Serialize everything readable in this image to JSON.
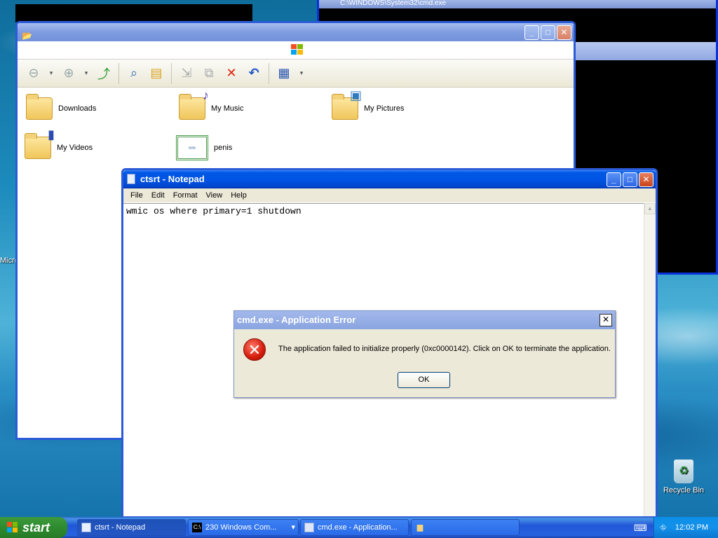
{
  "background_window": {
    "title": "C:\\WINDOWS\\System32\\cmd.exe"
  },
  "explorer": {
    "items": [
      {
        "label": "Downloads"
      },
      {
        "label": "My Music"
      },
      {
        "label": "My Pictures"
      },
      {
        "label": "My Videos"
      },
      {
        "label": "penis"
      }
    ]
  },
  "notepad": {
    "title": "ctsrt - Notepad",
    "menu": [
      "File",
      "Edit",
      "Format",
      "View",
      "Help"
    ],
    "content": "wmic os where primary=1 shutdown"
  },
  "dialog": {
    "title": "cmd.exe - Application Error",
    "message": "The application failed to initialize properly (0xc0000142). Click on OK to terminate the application.",
    "ok_label": "OK"
  },
  "desktop": {
    "recycle_bin_label": "Recycle Bin",
    "left_partial_label": "Micro"
  },
  "taskbar": {
    "start_label": "start",
    "tasks": [
      {
        "label": "ctsrt - Notepad"
      },
      {
        "label": "230 Windows Com..."
      },
      {
        "label": "cmd.exe - Application..."
      },
      {
        "label": ""
      }
    ],
    "clock": "12:02 PM"
  },
  "colors": {
    "title_active": "#0054e3",
    "start_green": "#2f8b2f",
    "error_red": "#d41b0b"
  }
}
